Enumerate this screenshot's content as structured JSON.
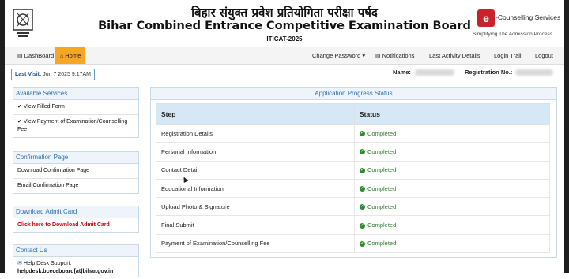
{
  "header": {
    "hindi_title": "बिहार संयुक्त प्रवेश प्रतियोगिता परीक्षा पर्षद",
    "title": "Bihar Combined Entrance Competitive Examination Board",
    "subtitle": "ITICAT-2025",
    "brand_name": "-Counselling Services",
    "brand_tagline": "Simplifying The Admission Process",
    "brand_letter": "e"
  },
  "nav": {
    "dashboard": "DashBoard",
    "home": "Home",
    "change_password": "Change Password",
    "notifications": "Notifications",
    "last_activity": "Last Activity Details",
    "login_trail": "Login Trail",
    "logout": "Logout"
  },
  "info": {
    "last_visit_label": "Last Visit:",
    "last_visit_value": "Jun 7 2025 9:17AM",
    "name_label": "Name:",
    "registration_label": "Registration No.:"
  },
  "sidebar": {
    "available_services": {
      "heading": "Available Services",
      "items": [
        "View Filled Form",
        "View Payment of Examination/Counselling Fee"
      ]
    },
    "confirmation": {
      "heading": "Confirmation Page",
      "items": [
        "Download Confirmation Page",
        "Email Confirmation Page"
      ]
    },
    "admit_card": {
      "heading": "Download Admit Card",
      "link": "Click here to Download Admit Card"
    },
    "contact": {
      "heading": "Contact Us",
      "helpdesk_label": "Help Desk Support:",
      "email": "helpdesk.bceceboard[at]bihar.gov.in"
    }
  },
  "progress": {
    "heading": "Application Progress Status",
    "col_step": "Step",
    "col_status": "Status",
    "rows": [
      {
        "step": "Registration Details",
        "status": "Completed"
      },
      {
        "step": "Personal Information",
        "status": "Completed"
      },
      {
        "step": "Contact Detail",
        "status": "Completed"
      },
      {
        "step": "Educational Information",
        "status": "Completed"
      },
      {
        "step": "Upload Photo & Signature",
        "status": "Completed"
      },
      {
        "step": "Final Submit",
        "status": "Completed"
      },
      {
        "step": "Payment of Examination/Counselling Fee",
        "status": "Completed"
      }
    ]
  },
  "colors": {
    "nav_active": "#f6a623",
    "accent_blue": "#2c6fb5",
    "completed_green": "#2e7d2e",
    "admit_red": "#d0021b"
  }
}
